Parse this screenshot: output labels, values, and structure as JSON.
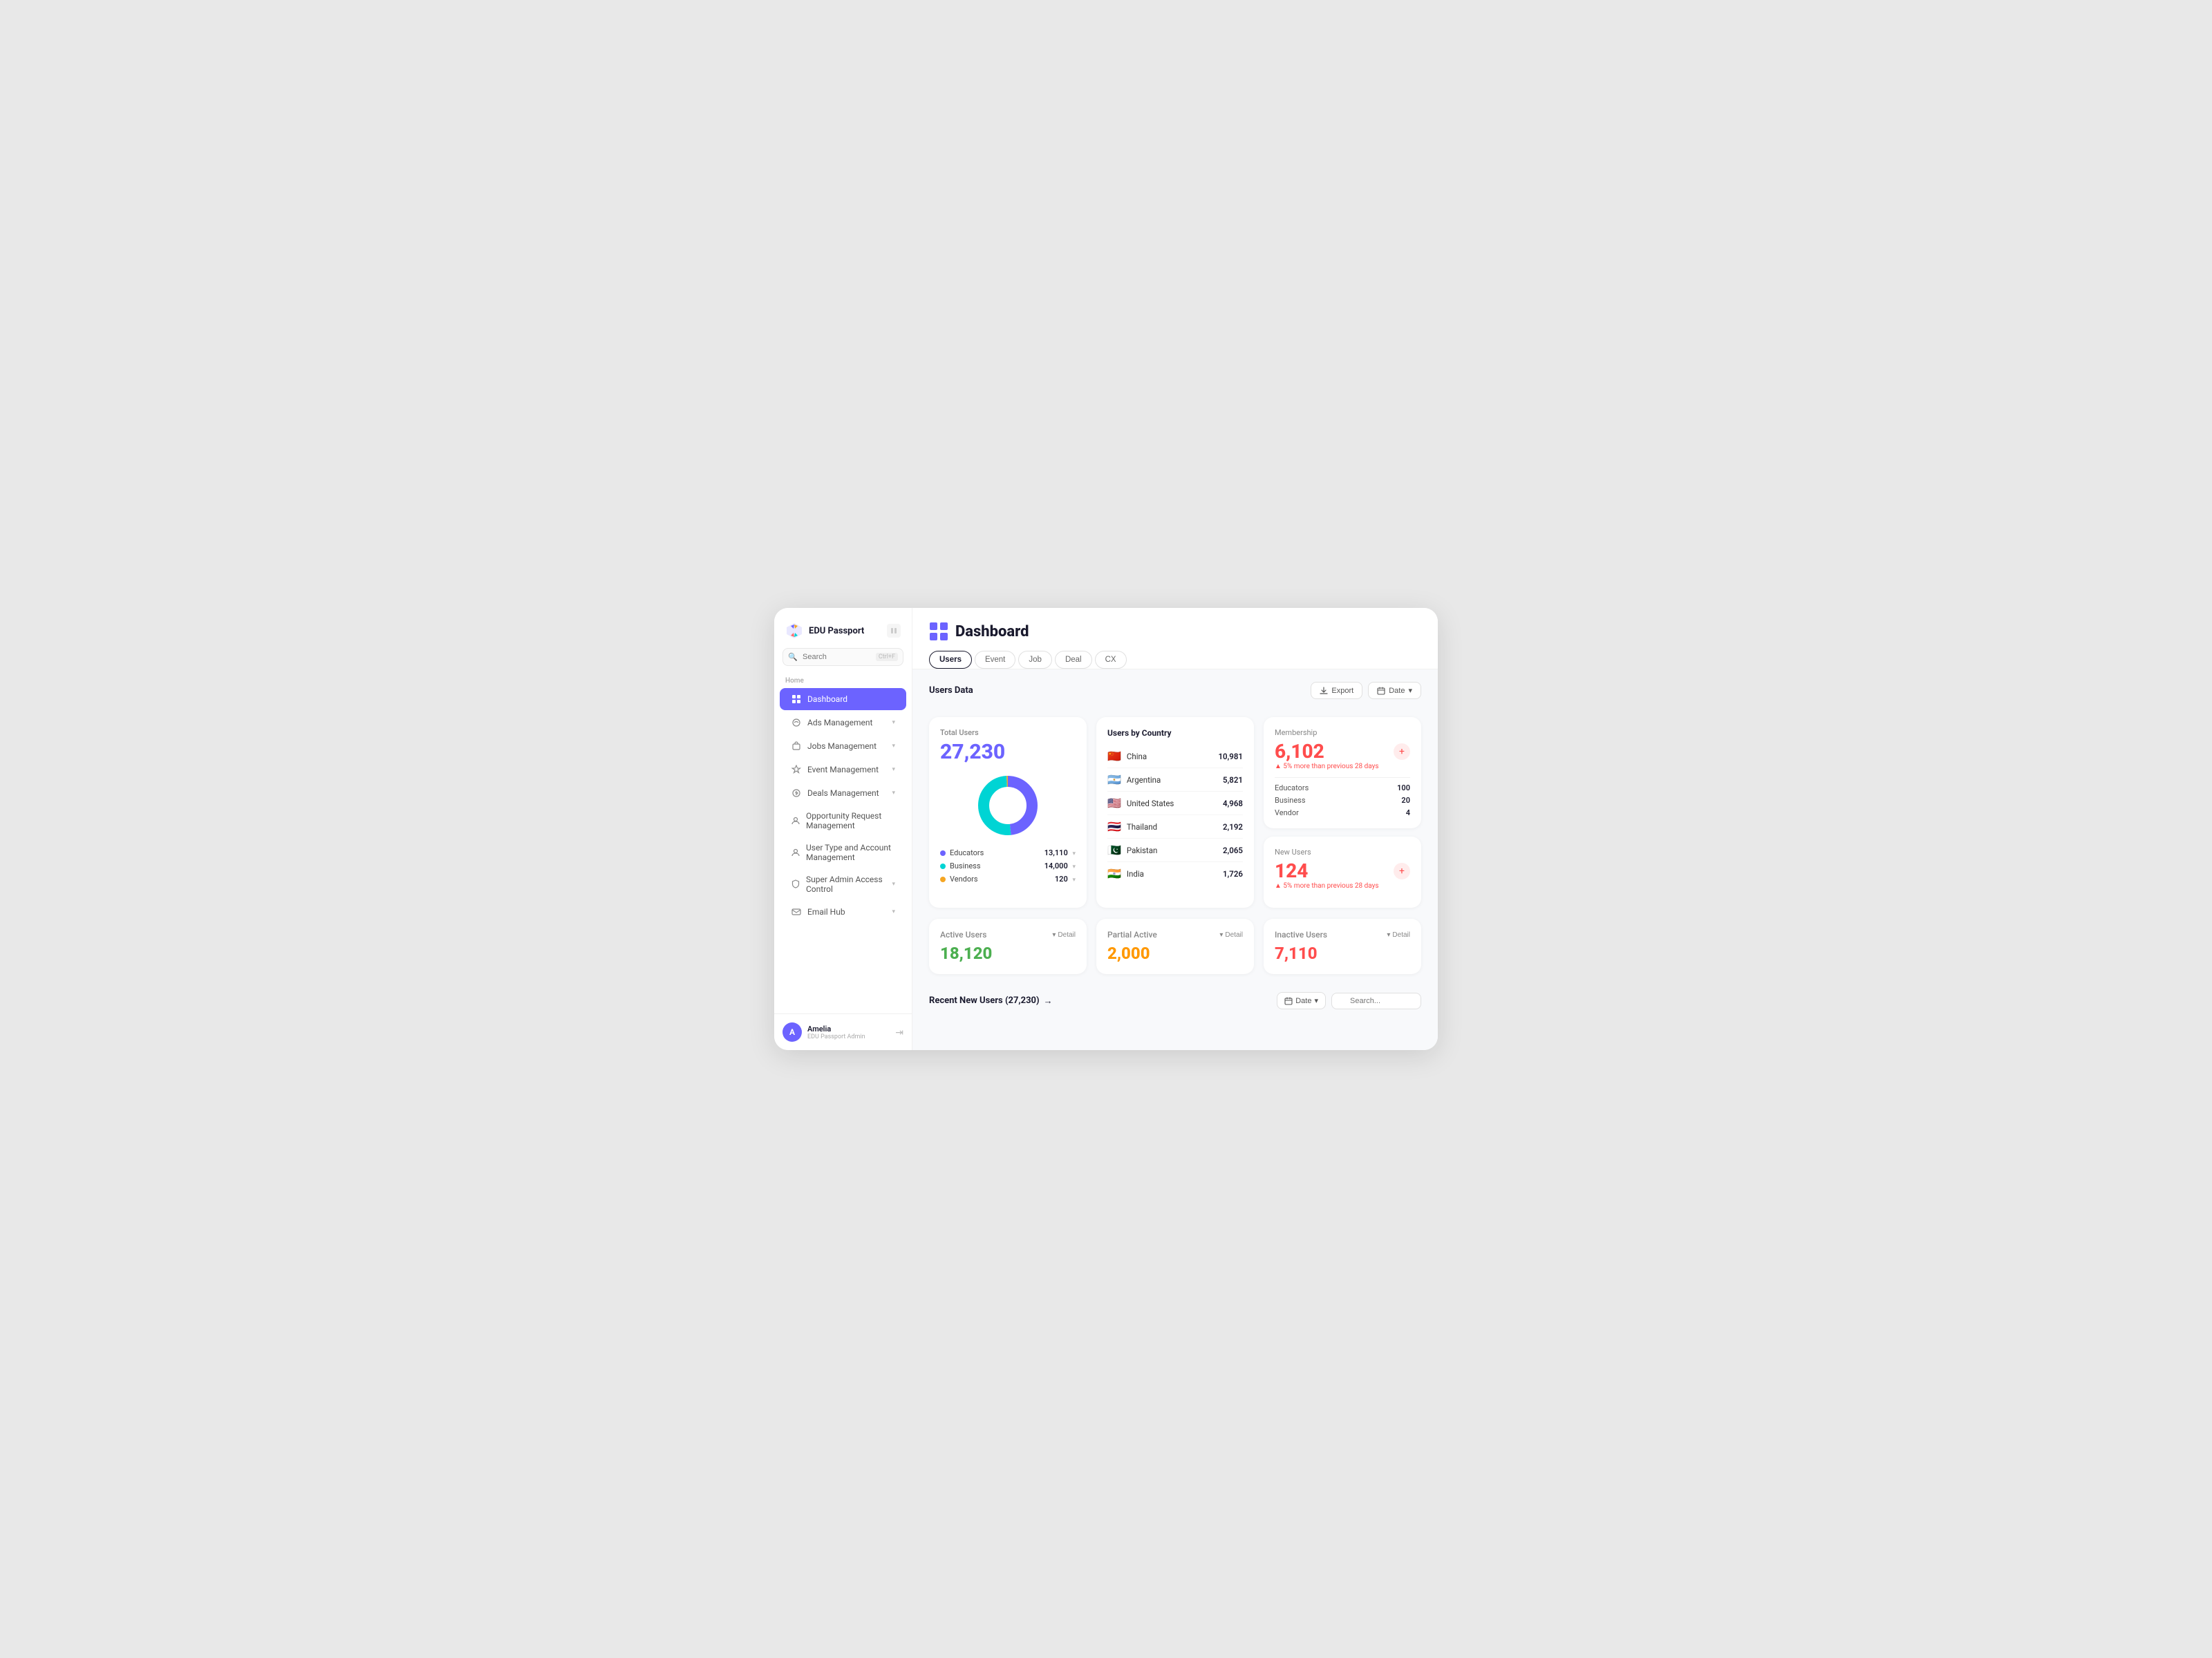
{
  "app": {
    "name": "EDU Passport"
  },
  "sidebar": {
    "search_placeholder": "Search",
    "search_shortcut": "Ctrl+F",
    "section_label": "Home",
    "nav_items": [
      {
        "id": "dashboard",
        "label": "Dashboard",
        "icon": "grid",
        "active": true,
        "has_chevron": false
      },
      {
        "id": "ads",
        "label": "Ads Management",
        "icon": "ads",
        "active": false,
        "has_chevron": true
      },
      {
        "id": "jobs",
        "label": "Jobs Management",
        "icon": "jobs",
        "active": false,
        "has_chevron": true
      },
      {
        "id": "events",
        "label": "Event Management",
        "icon": "events",
        "active": false,
        "has_chevron": true
      },
      {
        "id": "deals",
        "label": "Deals Management",
        "icon": "deals",
        "active": false,
        "has_chevron": true
      },
      {
        "id": "opportunity",
        "label": "Opportunity Request Management",
        "icon": "opportunity",
        "active": false,
        "has_chevron": false
      },
      {
        "id": "usertype",
        "label": "User Type and Account Management",
        "icon": "user",
        "active": false,
        "has_chevron": false
      },
      {
        "id": "superadmin",
        "label": "Super Admin Access Control",
        "icon": "shield",
        "active": false,
        "has_chevron": true
      },
      {
        "id": "emailhub",
        "label": "Email Hub",
        "icon": "email",
        "active": false,
        "has_chevron": true
      }
    ],
    "user": {
      "name": "Amelia",
      "role": "EDU Passport Admin",
      "avatar_letter": "A"
    }
  },
  "header": {
    "page_title": "Dashboard",
    "tabs": [
      "Users",
      "Event",
      "Job",
      "Deal",
      "CX"
    ],
    "active_tab": "Users"
  },
  "users_data": {
    "section_title": "Users Data",
    "export_label": "Export",
    "date_label": "Date",
    "total_users": {
      "label": "Total Users",
      "value": "27,230",
      "segments": [
        {
          "name": "Educators",
          "color": "#6c63ff",
          "value": 13110,
          "percent": 48
        },
        {
          "name": "Business",
          "color": "#00d4d4",
          "value": 14000,
          "percent": 51
        },
        {
          "name": "Vendors",
          "color": "#f5a623",
          "value": 120,
          "percent": 1
        }
      ]
    },
    "users_by_country": {
      "label": "Users by Country",
      "countries": [
        {
          "name": "China",
          "flag": "🇨🇳",
          "count": "10,981"
        },
        {
          "name": "Argentina",
          "flag": "🇦🇷",
          "count": "5,821"
        },
        {
          "name": "United States",
          "flag": "🇺🇸",
          "count": "4,968"
        },
        {
          "name": "Thailand",
          "flag": "🇹🇭",
          "count": "2,192"
        },
        {
          "name": "Pakistan",
          "flag": "🇵🇰",
          "count": "2,065"
        },
        {
          "name": "India",
          "flag": "🇮🇳",
          "count": "1,726"
        }
      ]
    },
    "membership": {
      "label": "Membership",
      "value": "6,102",
      "change": "▲ 5% more than previous 28 days",
      "breakdown": [
        {
          "label": "Educators",
          "value": "100"
        },
        {
          "label": "Business",
          "value": "20"
        },
        {
          "label": "Vendor",
          "value": "4"
        }
      ]
    },
    "new_users": {
      "label": "New Users",
      "value": "124",
      "change": "▲ 5% more than previous 28 days",
      "breakdown": []
    },
    "active_users": {
      "label": "Active Users",
      "value": "18,120",
      "detail_label": "Detail"
    },
    "partial_active": {
      "label": "Partial Active",
      "value": "2,000",
      "detail_label": "Detail"
    },
    "inactive_users": {
      "label": "Inactive Users",
      "value": "7,110",
      "detail_label": "Detail"
    },
    "recent_new_users": {
      "title": "Recent New Users (27,230)",
      "arrow": "→",
      "date_label": "Date",
      "search_placeholder": "Search..."
    }
  }
}
